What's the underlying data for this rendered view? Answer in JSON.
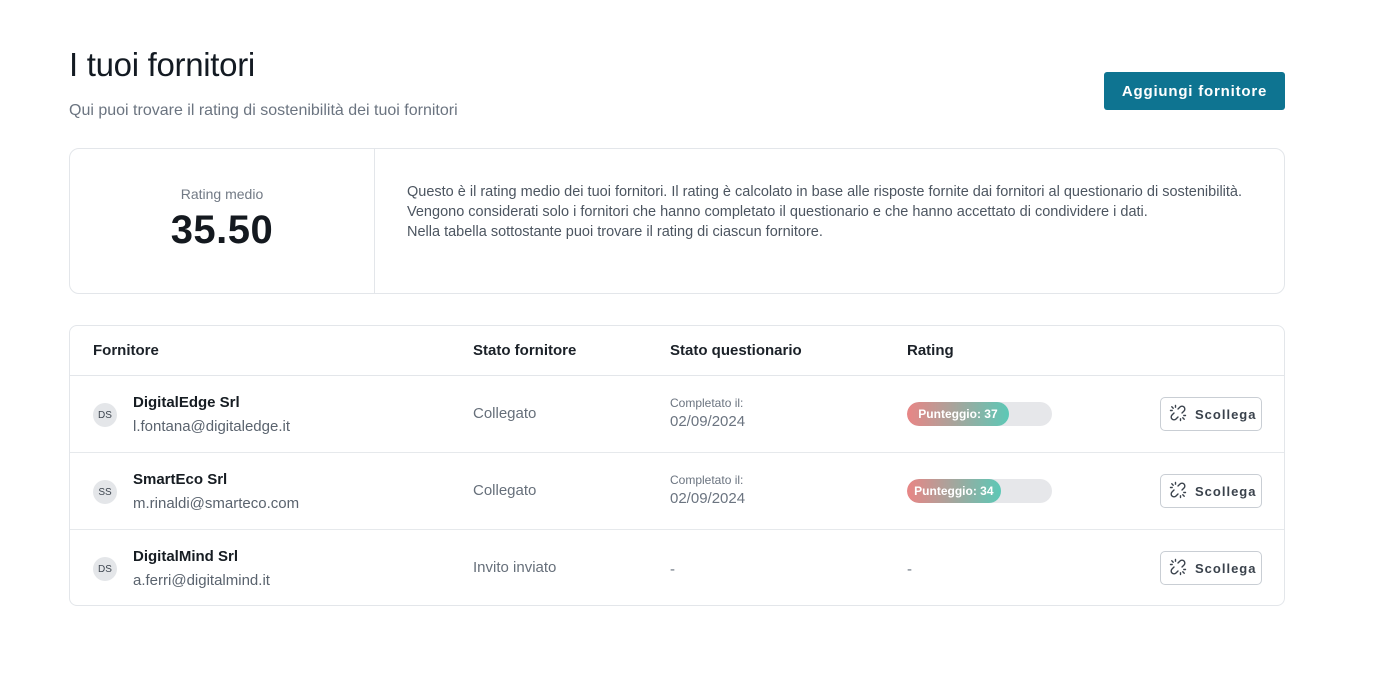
{
  "header": {
    "title": "I tuoi fornitori",
    "subtitle": "Qui puoi trovare il rating di sostenibilità dei tuoi fornitori",
    "add_button": "Aggiungi fornitore"
  },
  "summary": {
    "label": "Rating medio",
    "value": "35.50",
    "description": [
      "Questo è il rating medio dei tuoi fornitori. Il rating è calcolato in base alle risposte fornite dai fornitori al questionario di sostenibilità.",
      "Vengono considerati solo i fornitori che hanno completato il questionario e che hanno accettato di condividere i dati.",
      "Nella tabella sottostante puoi trovare il rating di ciascun fornitore."
    ]
  },
  "table": {
    "headers": [
      "Fornitore",
      "Stato fornitore",
      "Stato questionario",
      "Rating"
    ],
    "unlink_label": "Scollega",
    "completed_label": "Completato il:",
    "rows": [
      {
        "initials": "DS",
        "name": "DigitalEdge Srl",
        "email": "l.fontana@digitaledge.it",
        "status": "Collegato",
        "completed_on": "02/09/2024",
        "score_text": "Punteggio: 37",
        "score": 37
      },
      {
        "initials": "SS",
        "name": "SmartEco Srl",
        "email": "m.rinaldi@smarteco.com",
        "status": "Collegato",
        "completed_on": "02/09/2024",
        "score_text": "Punteggio: 34",
        "score": 34
      },
      {
        "initials": "DS",
        "name": "DigitalMind Srl",
        "email": "a.ferri@digitalmind.it",
        "status": "Invito inviato",
        "questionnaire": "-",
        "rating": "-"
      }
    ]
  },
  "colors": {
    "primary": "#0e7491",
    "bar_start": "#e98585",
    "bar_end": "#5cc8b6",
    "bar_track": "#e6e7ea"
  },
  "icons": {
    "unlink": "unlink-icon"
  }
}
